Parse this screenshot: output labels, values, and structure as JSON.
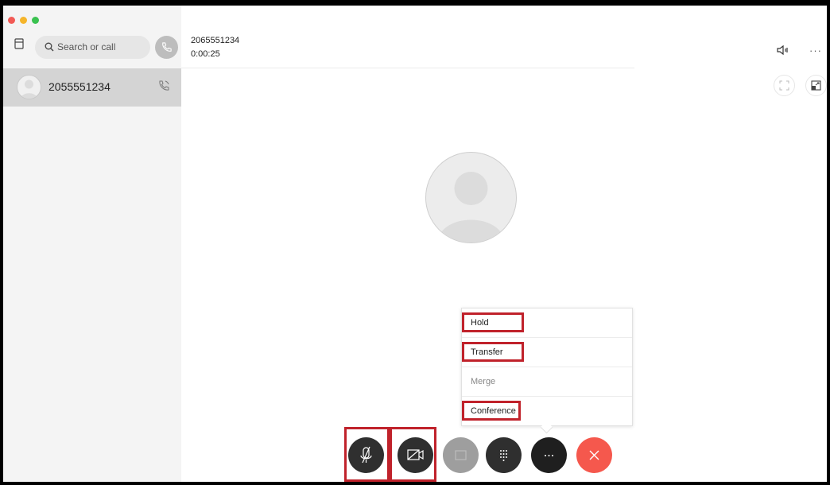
{
  "window": {
    "traffic_lights": [
      "close",
      "minimize",
      "zoom"
    ]
  },
  "sidebar": {
    "search": {
      "placeholder": "Search or call",
      "icon": "search-icon"
    },
    "contacts": [
      {
        "name": "2055551234",
        "icon": "phone-call-icon",
        "selected": true
      }
    ]
  },
  "call": {
    "number": "2065551234",
    "duration": "0:00:25"
  },
  "menu": {
    "items": [
      {
        "label": "Hold",
        "enabled": true,
        "highlighted": true
      },
      {
        "label": "Transfer",
        "enabled": true,
        "highlighted": true
      },
      {
        "label": "Merge",
        "enabled": false,
        "highlighted": false
      },
      {
        "label": "Conference",
        "enabled": true,
        "highlighted": true
      }
    ]
  },
  "controls": [
    {
      "name": "mute",
      "icon": "microphone-off-icon",
      "highlighted": true
    },
    {
      "name": "video",
      "icon": "video-off-icon",
      "highlighted": true
    },
    {
      "name": "share",
      "icon": "share-screen-icon",
      "enabled": false
    },
    {
      "name": "keypad",
      "icon": "keypad-icon"
    },
    {
      "name": "more",
      "icon": "more-icon"
    },
    {
      "name": "end-call",
      "icon": "close-icon"
    }
  ],
  "colors": {
    "highlight": "#c0222b",
    "end_call": "#f5584d",
    "control_dark": "#2f2f2f",
    "sidebar_bg": "#f4f4f4",
    "selected_row": "#d4d4d4"
  }
}
